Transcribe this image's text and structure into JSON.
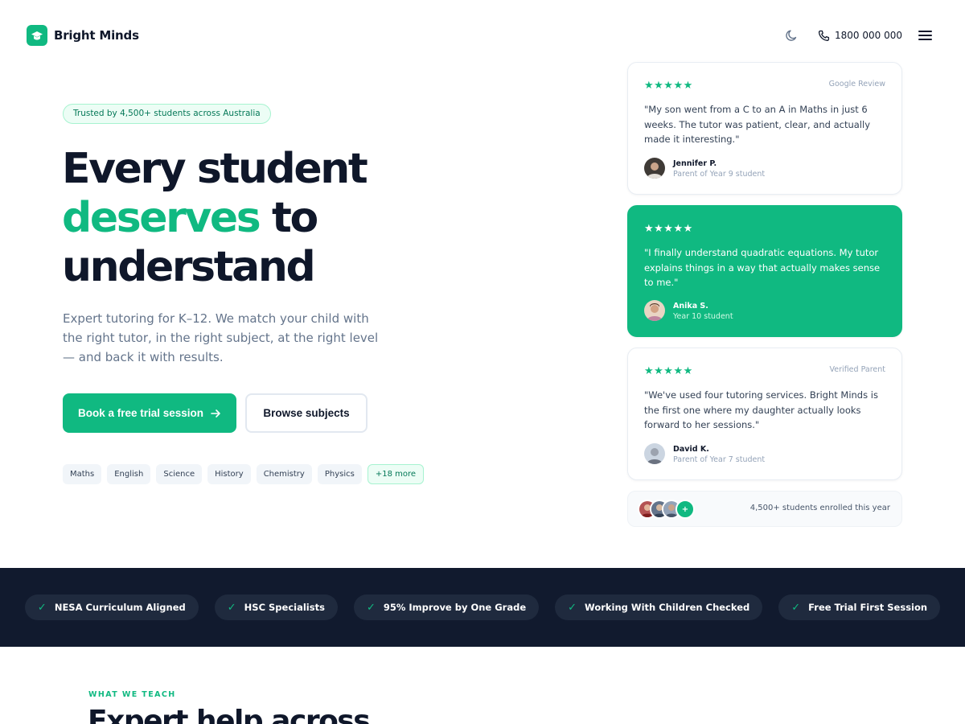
{
  "header": {
    "brand": "Bright Minds",
    "phone": "1800 000 000",
    "icons": [
      "graduation-cap-icon",
      "moon-icon",
      "phone-icon",
      "menu-icon"
    ]
  },
  "hero": {
    "trust_badge": "Trusted by 4,500+ students across Australia",
    "title_line1": "Every student",
    "title_green": "deserves",
    "title_to": " to",
    "title_line3": "understand",
    "subtitle": "Expert tutoring for K–12. We match your child with the right tutor, in the right subject, at the right level — and back it with results.",
    "primary_cta": "Book a free trial session",
    "secondary_cta": "Browse subjects",
    "subjects": [
      "Maths",
      "English",
      "Science",
      "History",
      "Chemistry",
      "Physics"
    ],
    "more_subjects": "+18 more"
  },
  "reviews": [
    {
      "stars": "★★★★★",
      "source": "Google Review",
      "quote": "\"My son went from a C to an A in Maths in just 6 weeks. The tutor was patient, clear, and actually made it interesting.\"",
      "name": "Jennifer P.",
      "role": "Parent of Year 9 student"
    },
    {
      "stars": "★★★★★",
      "source": "",
      "quote": "\"I finally understand quadratic equations. My tutor explains things in a way that actually makes sense to me.\"",
      "name": "Anika S.",
      "role": "Year 10 student"
    },
    {
      "stars": "★★★★★",
      "source": "Verified Parent",
      "quote": "\"We've used four tutoring services. Bright Minds is the first one where my daughter actually looks forward to her sessions.\"",
      "name": "David K.",
      "role": "Parent of Year 7 student"
    }
  ],
  "enrolled": {
    "plus": "+",
    "text": "4,500+ students enrolled this year"
  },
  "trust_band": {
    "check": "✓",
    "items": [
      "NESA Curriculum Aligned",
      "HSC Specialists",
      "95% Improve by One Grade",
      "Working With Children Checked",
      "Free Trial First Session"
    ]
  },
  "teach_section": {
    "eyebrow": "WHAT WE TEACH",
    "title": "Expert help across"
  },
  "colors": {
    "accent": "#10b981",
    "dark_band": "#111a2e",
    "text": "#0f172a"
  }
}
